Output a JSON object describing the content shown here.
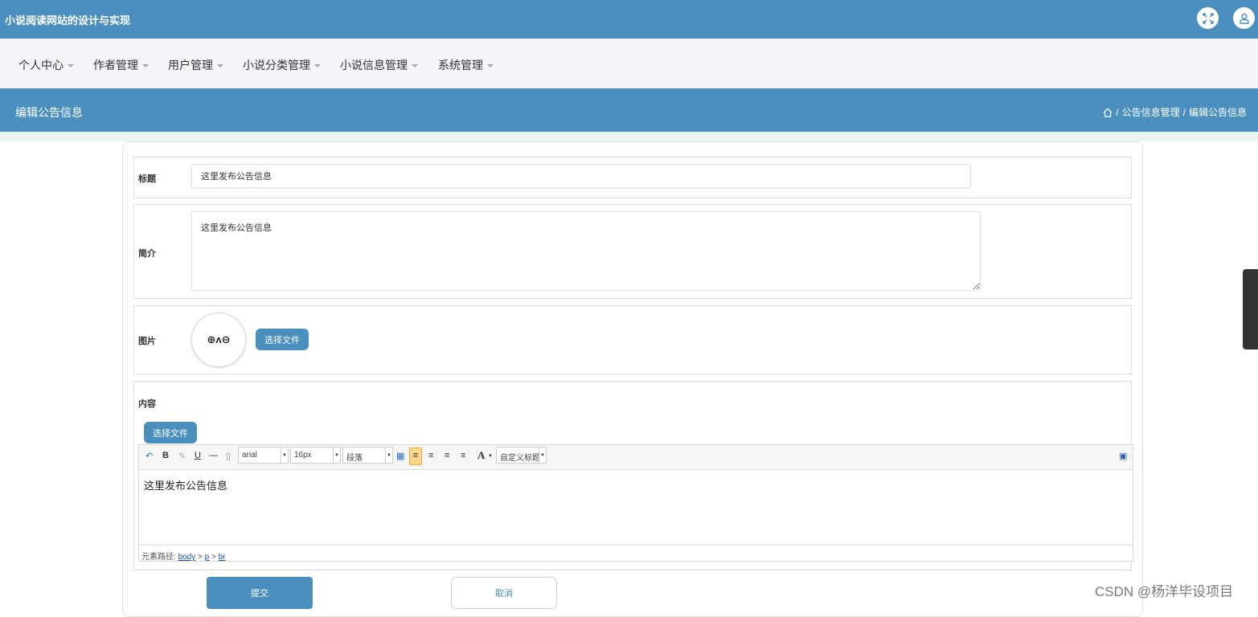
{
  "app": {
    "title": "小说阅读网站的设计与实现"
  },
  "nav": {
    "items": [
      {
        "label": "个人中心"
      },
      {
        "label": "作者管理"
      },
      {
        "label": "用户管理"
      },
      {
        "label": "小说分类管理"
      },
      {
        "label": "小说信息管理"
      },
      {
        "label": "系统管理"
      }
    ]
  },
  "page": {
    "title": "编辑公告信息",
    "breadcrumb": [
      "公告信息管理",
      "编辑公告信息"
    ],
    "breadcrumb_separator": "/"
  },
  "form": {
    "title": {
      "label": "标题",
      "value": "这里发布公告信息"
    },
    "intro": {
      "label": "简介",
      "value": "这里发布公告信息"
    },
    "image": {
      "label": "图片",
      "placeholder_glyphs": "⊕ʌ⊖",
      "choose_label": "选择文件"
    },
    "content": {
      "label": "内容",
      "choose_label": "选择文件",
      "editor": {
        "font_family": "arial",
        "font_size": "16px",
        "paragraph": "段落",
        "custom_title": "自定义标题",
        "toolbar_b": "B",
        "toolbar_u": "U",
        "toolbar_a": "A",
        "body_text": "这里发布公告信息",
        "path_label": "元素路径:",
        "path": [
          "body",
          "p",
          "br"
        ],
        "path_separator": ">"
      }
    },
    "submit_label": "提交",
    "cancel_label": "取消"
  },
  "watermark": "CSDN @杨洋毕设项目",
  "colors": {
    "primary": "#4a8fbd",
    "nav_bg": "#f5f4f8"
  }
}
